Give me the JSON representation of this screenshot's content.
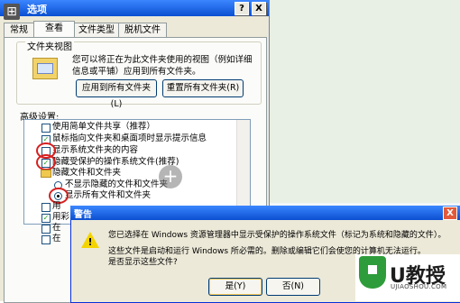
{
  "folder_options": {
    "title": "选项",
    "tabs": [
      "常规",
      "查看",
      "文件类型",
      "脱机文件"
    ],
    "folder_view_group": "文件夹视图",
    "folder_view_text_1": "您可以将正在为此文件夹使用的视图（例如详细",
    "folder_view_text_2": "信息或平铺）应用到所有文件夹。",
    "apply_all_button": "应用到所有文件夹(L)",
    "reset_all_button": "重置所有文件夹(R)",
    "advanced_label": "高级设置:",
    "settings": [
      "使用简单文件共享（推荐）",
      "鼠标指向文件夹和桌面项时显示提示信息",
      "显示系统文件夹的内容",
      "隐藏受保护的操作系统文件(推荐)",
      "隐藏文件和文件夹",
      "不显示隐藏的文件和文件夹",
      "显示所有文件和文件夹"
    ],
    "partial_rows": [
      "用",
      "用彩",
      "在",
      "在"
    ],
    "help_button": "?",
    "close_button": "X"
  },
  "warning": {
    "title": "警告",
    "message_1": "您已选择在 Windows 资源管理器中显示受保护的操作系统文件（标记为系统和隐藏的文件）。",
    "message_2": "这些文件是启动和运行 Windows 所必需的。删除或编辑它们会使您的计算机无法运行。",
    "message_3": "是否显示这些文件?",
    "yes_button": "是(Y)",
    "no_button": "否(N)",
    "close_button": "X",
    "icon": "warning-triangle-icon"
  },
  "watermark": {
    "brand": "U教授",
    "url": "UJIAOSHOU.COM"
  },
  "colors": {
    "title_bar": "#0a4fd0",
    "highlight_ring": "#d62020",
    "check": "#21a121"
  }
}
